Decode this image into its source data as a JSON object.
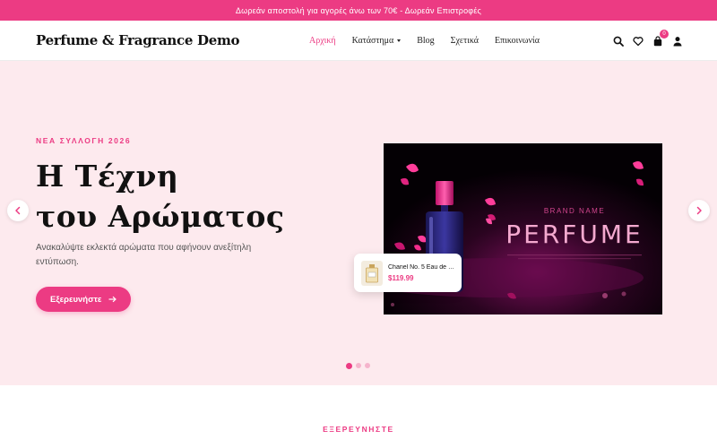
{
  "announcement": "Δωρεάν αποστολή για αγορές άνω των 70€ - Δωρεάν Επιστροφές",
  "header": {
    "logo": "Perfume & Fragrance Demo",
    "nav": [
      {
        "label": "Αρχική",
        "active": true
      },
      {
        "label": "Κατάστημα",
        "dropdown": true
      },
      {
        "label": "Blog"
      },
      {
        "label": "Σχετικά"
      },
      {
        "label": "Επικοινωνία"
      }
    ],
    "cart_count": "0",
    "icons": [
      "search-icon",
      "heart-icon",
      "bag-icon",
      "user-icon"
    ]
  },
  "hero": {
    "eyebrow": "ΝΕΑ ΣΥΛΛΟΓΗ 2026",
    "title_line1": "Η Τέχνη",
    "title_line2": "του Αρώματος",
    "subtitle": "Ανακαλύψτε εκλεκτά αρώματα που αφήνουν ανεξίτηλη εντύπωση.",
    "cta": "Εξερευνήστε",
    "banner": {
      "brand": "BRAND NAME",
      "word": "PERFUME"
    },
    "product_card": {
      "name": "Chanel No. 5 Eau de Pa...",
      "price": "$119.99"
    },
    "slides": 3,
    "active_slide": 0
  },
  "section": {
    "eyebrow": "ΕΞΕΡΕΥΝΗΣΤΕ"
  },
  "colors": {
    "accent": "#ec3b83",
    "hero_bg": "#fdeaee"
  }
}
